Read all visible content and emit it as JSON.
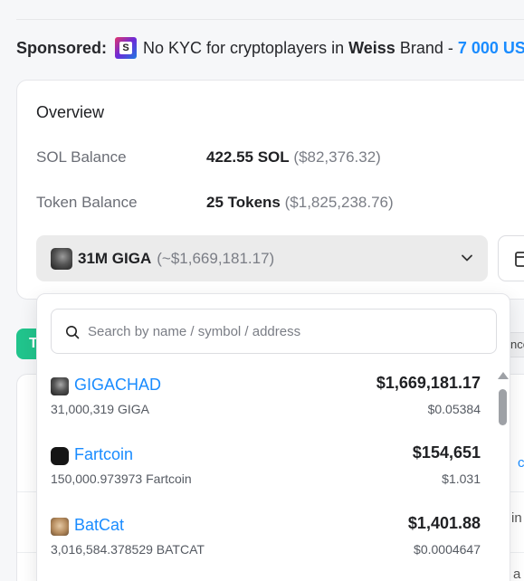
{
  "sponsored": {
    "label": "Sponsored:",
    "badge_letter": "S",
    "text_before": "No KYC for cryptoplayers in",
    "brand": "Weiss",
    "text_after": "Brand -",
    "amount": "7 000 US"
  },
  "overview": {
    "title": "Overview",
    "sol_label": "SOL Balance",
    "sol_amount": "422.55 SOL",
    "sol_usd": "($82,376.32)",
    "token_label": "Token Balance",
    "token_amount": "25 Tokens",
    "token_usd": "($1,825,238.76)"
  },
  "token_select": {
    "amount": "31M GIGA",
    "usd": "(~$1,669,181.17)"
  },
  "background": {
    "green_tab_text": "T",
    "right_pill_text": "nce",
    "edge_text_1": "c",
    "edge_text_2": "in",
    "edge_text_3": "a"
  },
  "dropdown": {
    "search_placeholder": "Search by name / symbol / address",
    "items": [
      {
        "name": "GIGACHAD",
        "quantity": "31,000,319 GIGA",
        "value": "$1,669,181.17",
        "price": "$0.05384",
        "icon": "gigachad-token-icon"
      },
      {
        "name": "Fartcoin",
        "quantity": "150,000.973973 Fartcoin",
        "value": "$154,651",
        "price": "$1.031",
        "icon": "fartcoin-token-icon"
      },
      {
        "name": "BatCat",
        "quantity": "3,016,584.378529 BATCAT",
        "value": "$1,401.88",
        "price": "$0.0004647",
        "icon": "batcat-token-icon"
      }
    ]
  },
  "colors": {
    "accent_blue": "#1a8cff",
    "green": "#21c48c",
    "muted_text": "#7a7d85"
  }
}
